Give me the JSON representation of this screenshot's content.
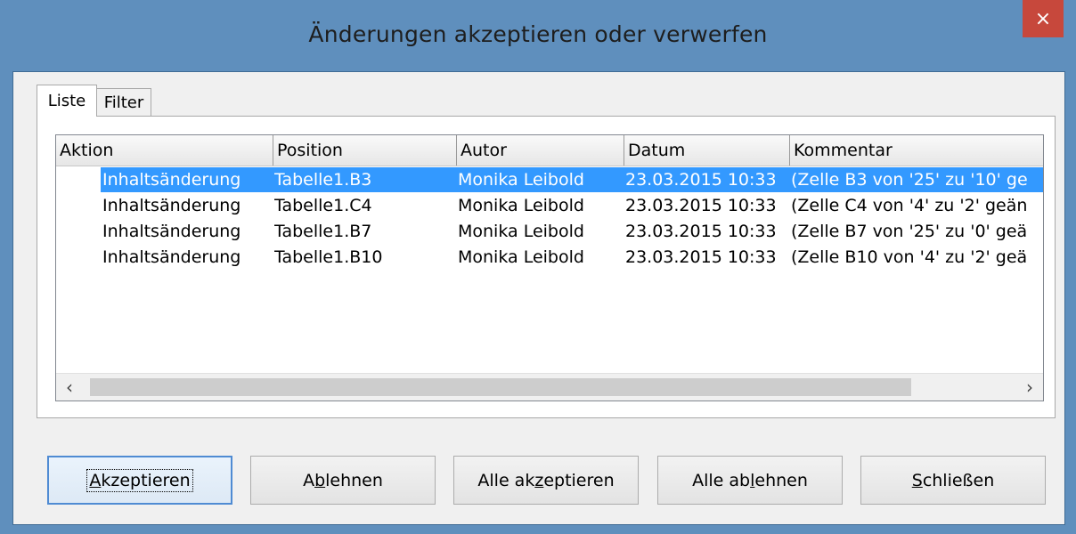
{
  "window": {
    "title": "Änderungen akzeptieren oder verwerfen",
    "close_glyph": "×"
  },
  "tabs": [
    {
      "label": "Liste",
      "active": true
    },
    {
      "label": "Filter",
      "active": false
    }
  ],
  "table": {
    "columns": [
      "Aktion",
      "Position",
      "Autor",
      "Datum",
      "Kommentar"
    ],
    "rows": [
      {
        "aktion": "Inhaltsänderung",
        "position": "Tabelle1.B3",
        "autor": "Monika Leibold",
        "datum": "23.03.2015 10:33",
        "kommentar": "(Zelle B3 von '25' zu '10' ge",
        "selected": true
      },
      {
        "aktion": "Inhaltsänderung",
        "position": "Tabelle1.C4",
        "autor": "Monika Leibold",
        "datum": "23.03.2015 10:33",
        "kommentar": "(Zelle C4 von '4' zu '2' geän",
        "selected": false
      },
      {
        "aktion": "Inhaltsänderung",
        "position": "Tabelle1.B7",
        "autor": "Monika Leibold",
        "datum": "23.03.2015 10:33",
        "kommentar": "(Zelle B7 von '25' zu '0' geä",
        "selected": false
      },
      {
        "aktion": "Inhaltsänderung",
        "position": "Tabelle1.B10",
        "autor": "Monika Leibold",
        "datum": "23.03.2015 10:33",
        "kommentar": "(Zelle B10 von '4' zu '2' geä",
        "selected": false
      }
    ]
  },
  "scrollbar": {
    "left_arrow": "‹",
    "right_arrow": "›"
  },
  "buttons": {
    "accept": {
      "pre": "",
      "mnemonic": "A",
      "post": "kzeptieren"
    },
    "reject": {
      "pre": "A",
      "mnemonic": "b",
      "post": "lehnen"
    },
    "accept_all": {
      "pre": "Alle ak",
      "mnemonic": "z",
      "post": "eptieren"
    },
    "reject_all": {
      "pre": "Alle ab",
      "mnemonic": "l",
      "post": "ehnen"
    },
    "close": {
      "pre": "",
      "mnemonic": "S",
      "post": "chließen"
    }
  },
  "colors": {
    "title_bar": "#5f8fbd",
    "close_button": "#c7483c",
    "selection": "#3399ff"
  }
}
